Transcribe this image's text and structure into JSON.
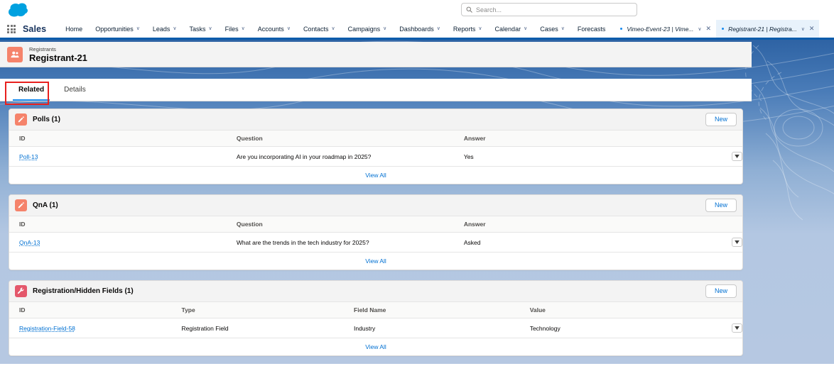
{
  "globalheader": {
    "logo_icon": "salesforce-cloud-logo",
    "search": {
      "icon": "search-icon",
      "value": "",
      "placeholder": "Search..."
    }
  },
  "nav": {
    "app_launcher_icon": "app-launcher-grid-icon",
    "app_name": "Sales",
    "items": [
      {
        "label": "Home",
        "has_menu": false
      },
      {
        "label": "Opportunities",
        "has_menu": true
      },
      {
        "label": "Leads",
        "has_menu": true
      },
      {
        "label": "Tasks",
        "has_menu": true
      },
      {
        "label": "Files",
        "has_menu": true
      },
      {
        "label": "Accounts",
        "has_menu": true
      },
      {
        "label": "Contacts",
        "has_menu": true
      },
      {
        "label": "Campaigns",
        "has_menu": true
      },
      {
        "label": "Dashboards",
        "has_menu": true
      },
      {
        "label": "Reports",
        "has_menu": true
      },
      {
        "label": "Calendar",
        "has_menu": true
      },
      {
        "label": "Cases",
        "has_menu": true
      },
      {
        "label": "Forecasts",
        "has_menu": false
      }
    ],
    "record_tabs": [
      {
        "label": "Vimeo-Event-23 | Vime...",
        "unsaved": true,
        "active": false
      },
      {
        "label": "Registrant-21 | Registra...",
        "unsaved": true,
        "active": true
      }
    ],
    "caret_glyph": "∨",
    "close_glyph": "✕",
    "bottom_border_color": "#0b5cab"
  },
  "record": {
    "object_icon": "registrants-object-icon",
    "object_label": "Registrants",
    "title": "Registrant-21",
    "icon_color": "#f5836b"
  },
  "page_tabs": {
    "items": [
      {
        "label": "Related",
        "active": true
      },
      {
        "label": "Details",
        "active": false
      }
    ],
    "active_underline_color": "#1589ee",
    "annotation_color": "#e8201e"
  },
  "related_lists": [
    {
      "title": "Polls (1)",
      "icon": "poll-edit-icon",
      "icon_color": "#f5836b",
      "new_label": "New",
      "view_all_label": "View All",
      "columns": [
        "ID",
        "Question",
        "Answer"
      ],
      "col_widths": [
        "31%",
        "31%",
        "32%",
        "6%"
      ],
      "rows": [
        {
          "id": "Poll-13",
          "cells": [
            "Are you incorporating AI in your roadmap in 2025?",
            "Yes"
          ],
          "row_menu_icon": "chevron-down-icon"
        }
      ]
    },
    {
      "title": "QnA (1)",
      "icon": "qna-edit-icon",
      "icon_color": "#f5836b",
      "new_label": "New",
      "view_all_label": "View All",
      "columns": [
        "ID",
        "Question",
        "Answer"
      ],
      "col_widths": [
        "31%",
        "31%",
        "32%",
        "6%"
      ],
      "rows": [
        {
          "id": "QnA-13",
          "cells": [
            "What are the trends in the tech industry for 2025?",
            "Asked"
          ],
          "row_menu_icon": "chevron-down-icon"
        }
      ]
    },
    {
      "title": "Registration/Hidden Fields (1)",
      "icon": "registration-field-wrench-icon",
      "icon_color": "#e4576b",
      "new_label": "New",
      "view_all_label": "View All",
      "columns": [
        "ID",
        "Type",
        "Field Name",
        "Value"
      ],
      "col_widths": [
        "23.5%",
        "23.5%",
        "24%",
        "23%",
        "6%"
      ],
      "rows": [
        {
          "id": "Registration-Field-58",
          "cells": [
            "Registration Field",
            "Industry",
            "Technology"
          ],
          "row_menu_icon": "chevron-down-icon"
        }
      ]
    }
  ]
}
